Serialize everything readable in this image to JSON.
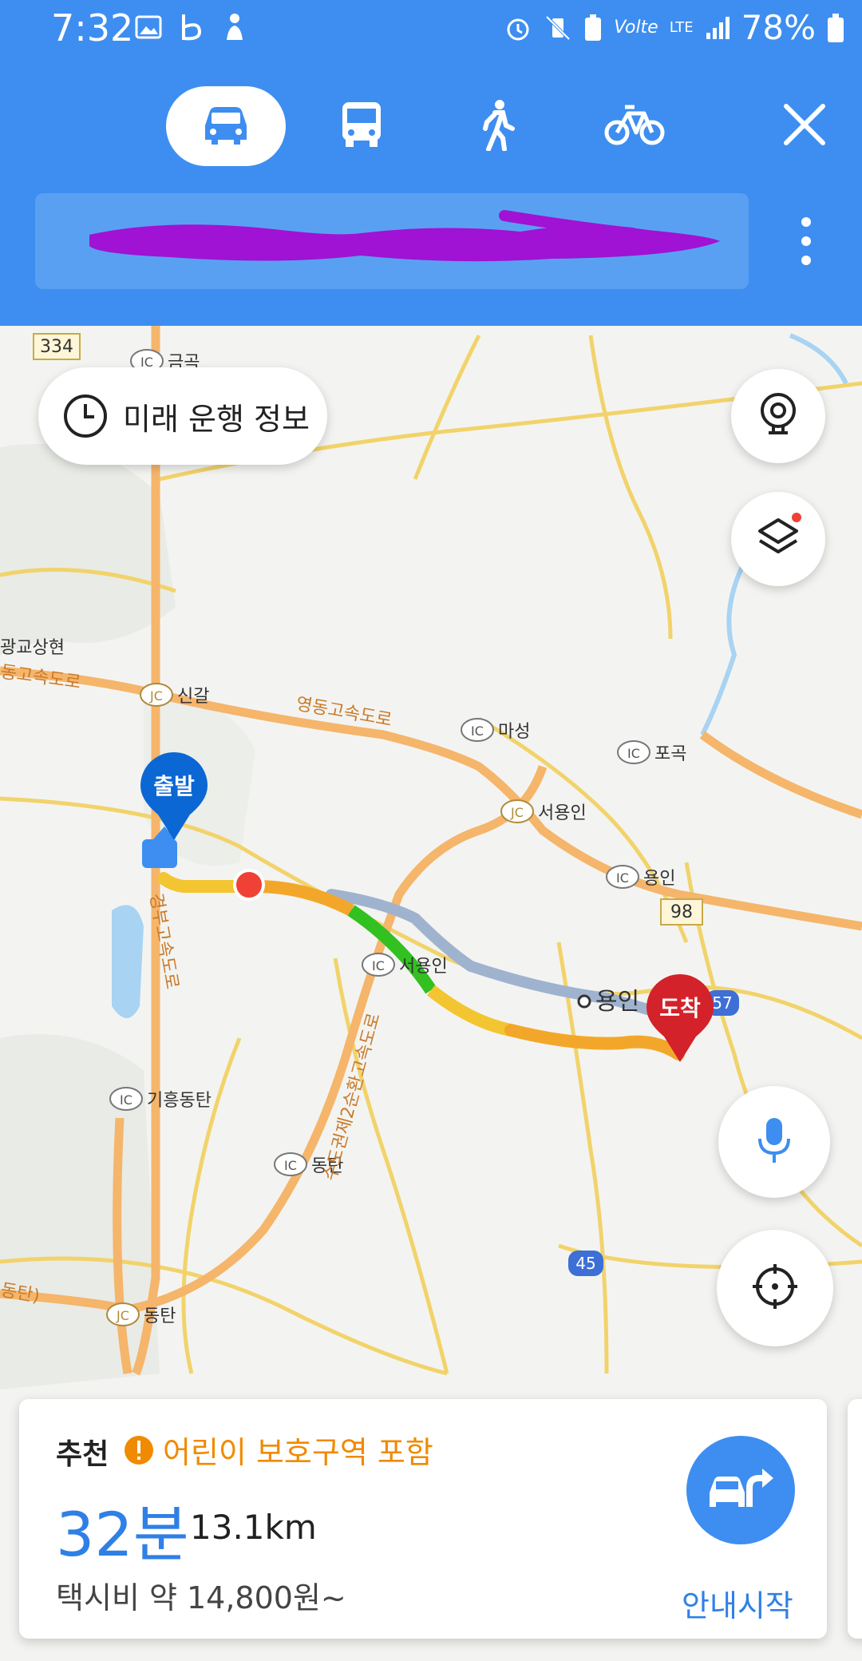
{
  "status_bar": {
    "time": "7:32",
    "battery": "78%",
    "network": "LTE"
  },
  "transport_modes": [
    {
      "name": "car",
      "icon": "car-icon",
      "active": true
    },
    {
      "name": "bus",
      "icon": "bus-icon",
      "active": false
    },
    {
      "name": "walk",
      "icon": "walk-icon",
      "active": false
    },
    {
      "name": "bike",
      "icon": "bike-icon",
      "active": false
    }
  ],
  "future_info": {
    "label": "미래 운행 정보"
  },
  "map": {
    "markers": {
      "start": "출발",
      "end": "도착"
    },
    "places": [
      "금곡",
      "신갈",
      "마성",
      "포곡",
      "서용인",
      "용인",
      "서용인",
      "기흥동탄",
      "동탄",
      "동탄",
      "용인",
      "광교상현"
    ],
    "roads": [
      "영동고속도로",
      "동고속도로",
      "경부고속도로",
      "수도권제2순환고속도로",
      "동탄)"
    ],
    "route_shields": [
      "334",
      "98",
      "57",
      "45"
    ],
    "junction_tag": "JC",
    "ic_tag": "IC"
  },
  "route": {
    "tag": "추천",
    "warning": "어린이 보호구역 포함",
    "duration": "32분",
    "distance": "13.1km",
    "taxi_fare": "택시비 약 14,800원~",
    "start_nav": "안내시작"
  },
  "colors": {
    "accent": "#3d8ef0",
    "warning": "#f08a00",
    "route_orange": "#f3a72a",
    "route_green": "#33c021"
  }
}
